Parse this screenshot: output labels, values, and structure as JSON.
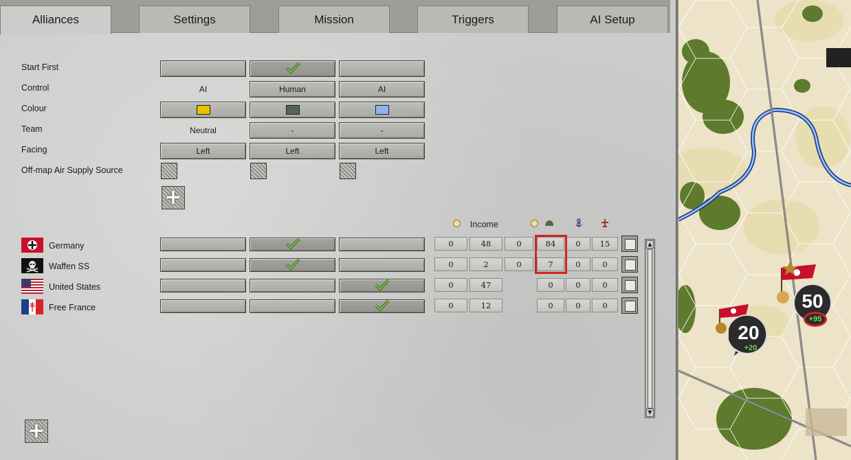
{
  "tabs": [
    "Alliances",
    "Settings",
    "Mission",
    "Triggers",
    "AI Setup"
  ],
  "settings": {
    "start_first": "Start First",
    "control": "Control",
    "colour": "Colour",
    "team": "Team",
    "facing": "Facing",
    "air_supply": "Off-map Air Supply Source"
  },
  "control_values": [
    "AI",
    "Human",
    "AI"
  ],
  "team_values": [
    "Neutral",
    "-",
    "-"
  ],
  "facing_values": [
    "Left",
    "Left",
    "Left"
  ],
  "colours": [
    "#e6c200",
    "#556458",
    "#8fb4f0"
  ],
  "columns": {
    "income": "Income"
  },
  "factions": [
    {
      "name": "Germany",
      "values": [
        "0",
        "48",
        "0",
        "84",
        "0",
        "15"
      ]
    },
    {
      "name": "Waffen SS",
      "values": [
        "0",
        "2",
        "0",
        "7",
        "0",
        "0"
      ]
    },
    {
      "name": "United States",
      "values": [
        "0",
        "47",
        "",
        "0",
        "0",
        "0"
      ]
    },
    {
      "name": "Free France",
      "values": [
        "0",
        "12",
        "",
        "0",
        "0",
        "0"
      ]
    }
  ],
  "map": {
    "counter_a": {
      "value": "50",
      "bonus": "+95"
    },
    "counter_b": {
      "value": "20",
      "bonus": "+20"
    }
  }
}
